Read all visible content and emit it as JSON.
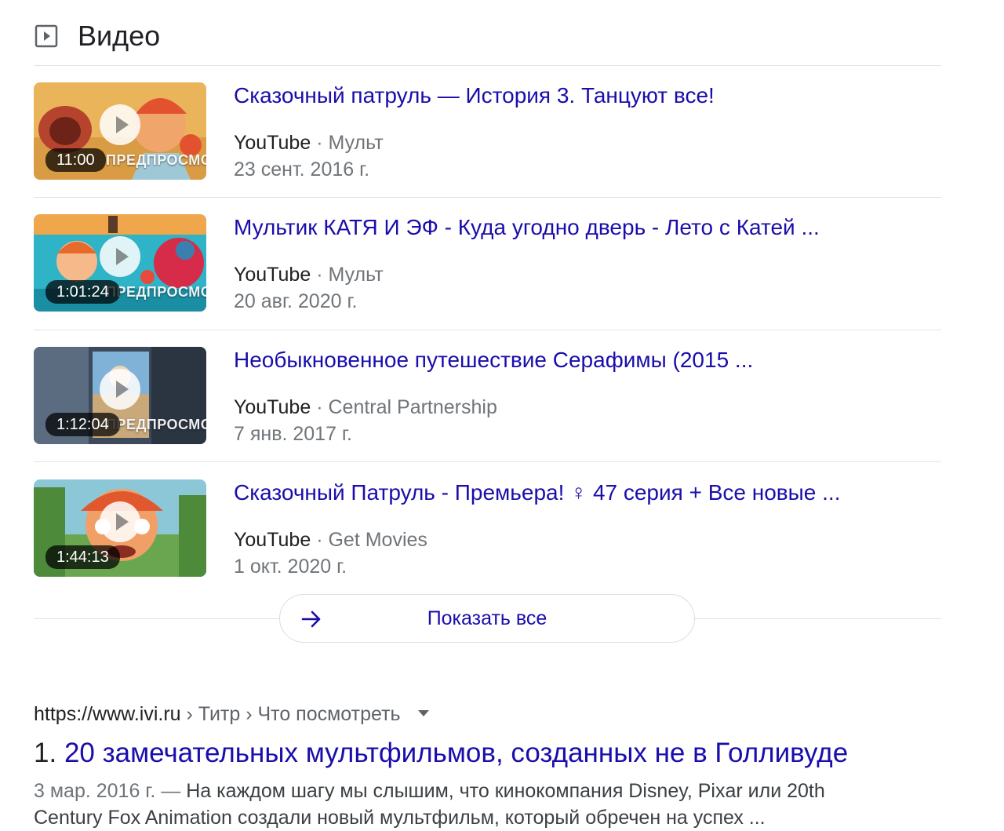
{
  "section": {
    "icon": "video-play-icon",
    "title": "Видео"
  },
  "videos": [
    {
      "title": "Сказочный патруль — История 3. Танцуют все!",
      "source": "YouTube",
      "separator": "·",
      "channel": "Мульт",
      "date": "23 сент. 2016 г.",
      "duration": "11:00",
      "preview_label": "ПРЕДПРОСМОТР"
    },
    {
      "title": "Мультик КАТЯ И ЭФ - Куда угодно дверь - Лето с Катей ...",
      "source": "YouTube",
      "separator": "·",
      "channel": "Мульт",
      "date": "20 авг. 2020 г.",
      "duration": "1:01:24",
      "preview_label": "ПРЕДПРОСМОТР"
    },
    {
      "title": "Необыкновенное путешествие Серафимы (2015 ...",
      "source": "YouTube",
      "separator": "·",
      "channel": "Central Partnership",
      "date": "7 янв. 2017 г.",
      "duration": "1:12:04",
      "preview_label": "ПРЕДПРОСМОТР"
    },
    {
      "title": "Сказочный Патруль - Премьера! ♀ 47 серия + Все новые ...",
      "source": "YouTube",
      "separator": "·",
      "channel": "Get Movies",
      "date": "1 окт. 2020 г.",
      "duration": "1:44:13",
      "preview_label": ""
    }
  ],
  "show_all": {
    "icon": "arrow-right-icon",
    "label": "Показать все"
  },
  "result": {
    "domain": "https://www.ivi.ru",
    "path": " › Титр › Что посмотреть",
    "number": "1.",
    "title": "20 замечательных мультфильмов, созданных не в Голливуде",
    "date": "3 мар. 2016 г. —",
    "snippet": "На каждом шагу мы слышим, что кинокомпания Disney, Pixar или 20th Century Fox Animation создали новый мультфильм, который обречен на успех ..."
  },
  "colors": {
    "link": "#1a0dab",
    "text": "#202124",
    "muted": "#70757a",
    "divider": "#e3e3e3"
  }
}
